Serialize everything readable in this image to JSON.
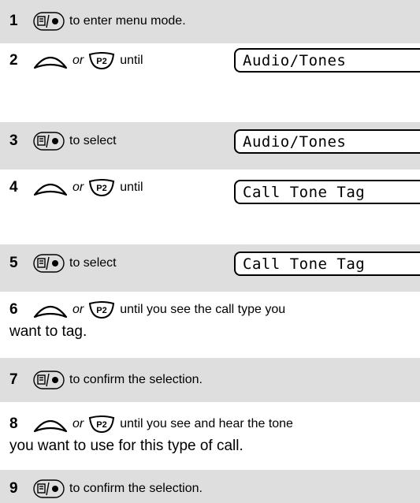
{
  "steps": [
    {
      "num": "1",
      "text": "to enter menu mode."
    },
    {
      "num": "2",
      "or": "or",
      "text": "until",
      "display": "Audio/Tones"
    },
    {
      "num": "3",
      "text": "to select",
      "display": "Audio/Tones"
    },
    {
      "num": "4",
      "or": "or",
      "text": "until",
      "display": "Call Tone Tag"
    },
    {
      "num": "5",
      "text": "to select",
      "display": "Call Tone Tag"
    },
    {
      "num": "6",
      "or": "or",
      "text": "until you see the call type you",
      "text2": "want to tag."
    },
    {
      "num": "7",
      "text": "to confirm the selection."
    },
    {
      "num": "8",
      "or": "or",
      "text": "until you see and hear the tone",
      "text2": "you want to use for this type of call."
    },
    {
      "num": "9",
      "text": "to confirm the selection."
    }
  ],
  "icons": {
    "menu_key": "menu-select-key-icon",
    "up_key": "up-arrow-key-icon",
    "p2_key": "p2-button-icon"
  }
}
